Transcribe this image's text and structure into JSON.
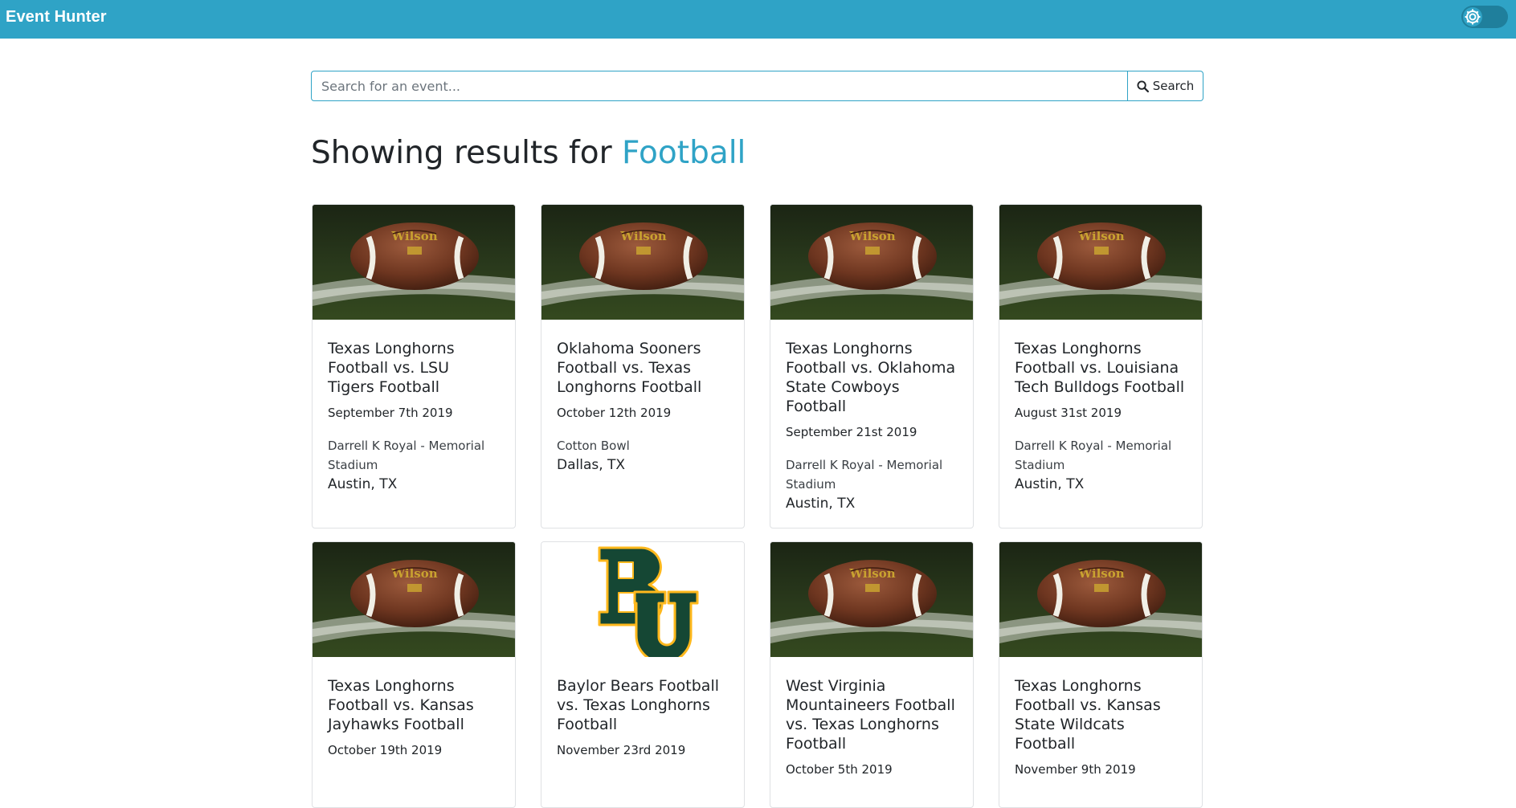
{
  "navbar": {
    "brand": "Event Hunter",
    "settings_icon": "gear-icon"
  },
  "search": {
    "placeholder": "Search for an event...",
    "value": "",
    "button_label": "Search",
    "button_icon": "search-icon"
  },
  "results": {
    "prefix": "Showing results for ",
    "term": "Football"
  },
  "colors": {
    "accent": "#2fa3c6",
    "baylor_green": "#154734",
    "baylor_gold": "#FFB81C"
  },
  "events": [
    {
      "image": "football",
      "title": "Texas Longhorns Football vs. LSU Tigers Football",
      "date": "September 7th 2019",
      "venue": "Darrell K Royal - Memorial Stadium",
      "city": "Austin, TX"
    },
    {
      "image": "football",
      "title": "Oklahoma Sooners Football vs. Texas Longhorns Football",
      "date": "October 12th 2019",
      "venue": "Cotton Bowl",
      "city": "Dallas, TX"
    },
    {
      "image": "football",
      "title": "Texas Longhorns Football vs. Oklahoma State Cowboys Football",
      "date": "September 21st 2019",
      "venue": "Darrell K Royal - Memorial Stadium",
      "city": "Austin, TX"
    },
    {
      "image": "football",
      "title": "Texas Longhorns Football vs. Louisiana Tech Bulldogs Football",
      "date": "August 31st 2019",
      "venue": "Darrell K Royal - Memorial Stadium",
      "city": "Austin, TX"
    },
    {
      "image": "football",
      "title": "Texas Longhorns Football vs. Kansas Jayhawks Football",
      "date": "October 19th 2019",
      "venue": "",
      "city": ""
    },
    {
      "image": "baylor-logo",
      "title": "Baylor Bears Football vs. Texas Longhorns Football",
      "date": "November 23rd 2019",
      "venue": "",
      "city": ""
    },
    {
      "image": "football",
      "title": "West Virginia Mountaineers Football vs. Texas Longhorns Football",
      "date": "October 5th 2019",
      "venue": "",
      "city": ""
    },
    {
      "image": "football",
      "title": "Texas Longhorns Football vs. Kansas State Wildcats Football",
      "date": "November 9th 2019",
      "venue": "",
      "city": ""
    }
  ]
}
